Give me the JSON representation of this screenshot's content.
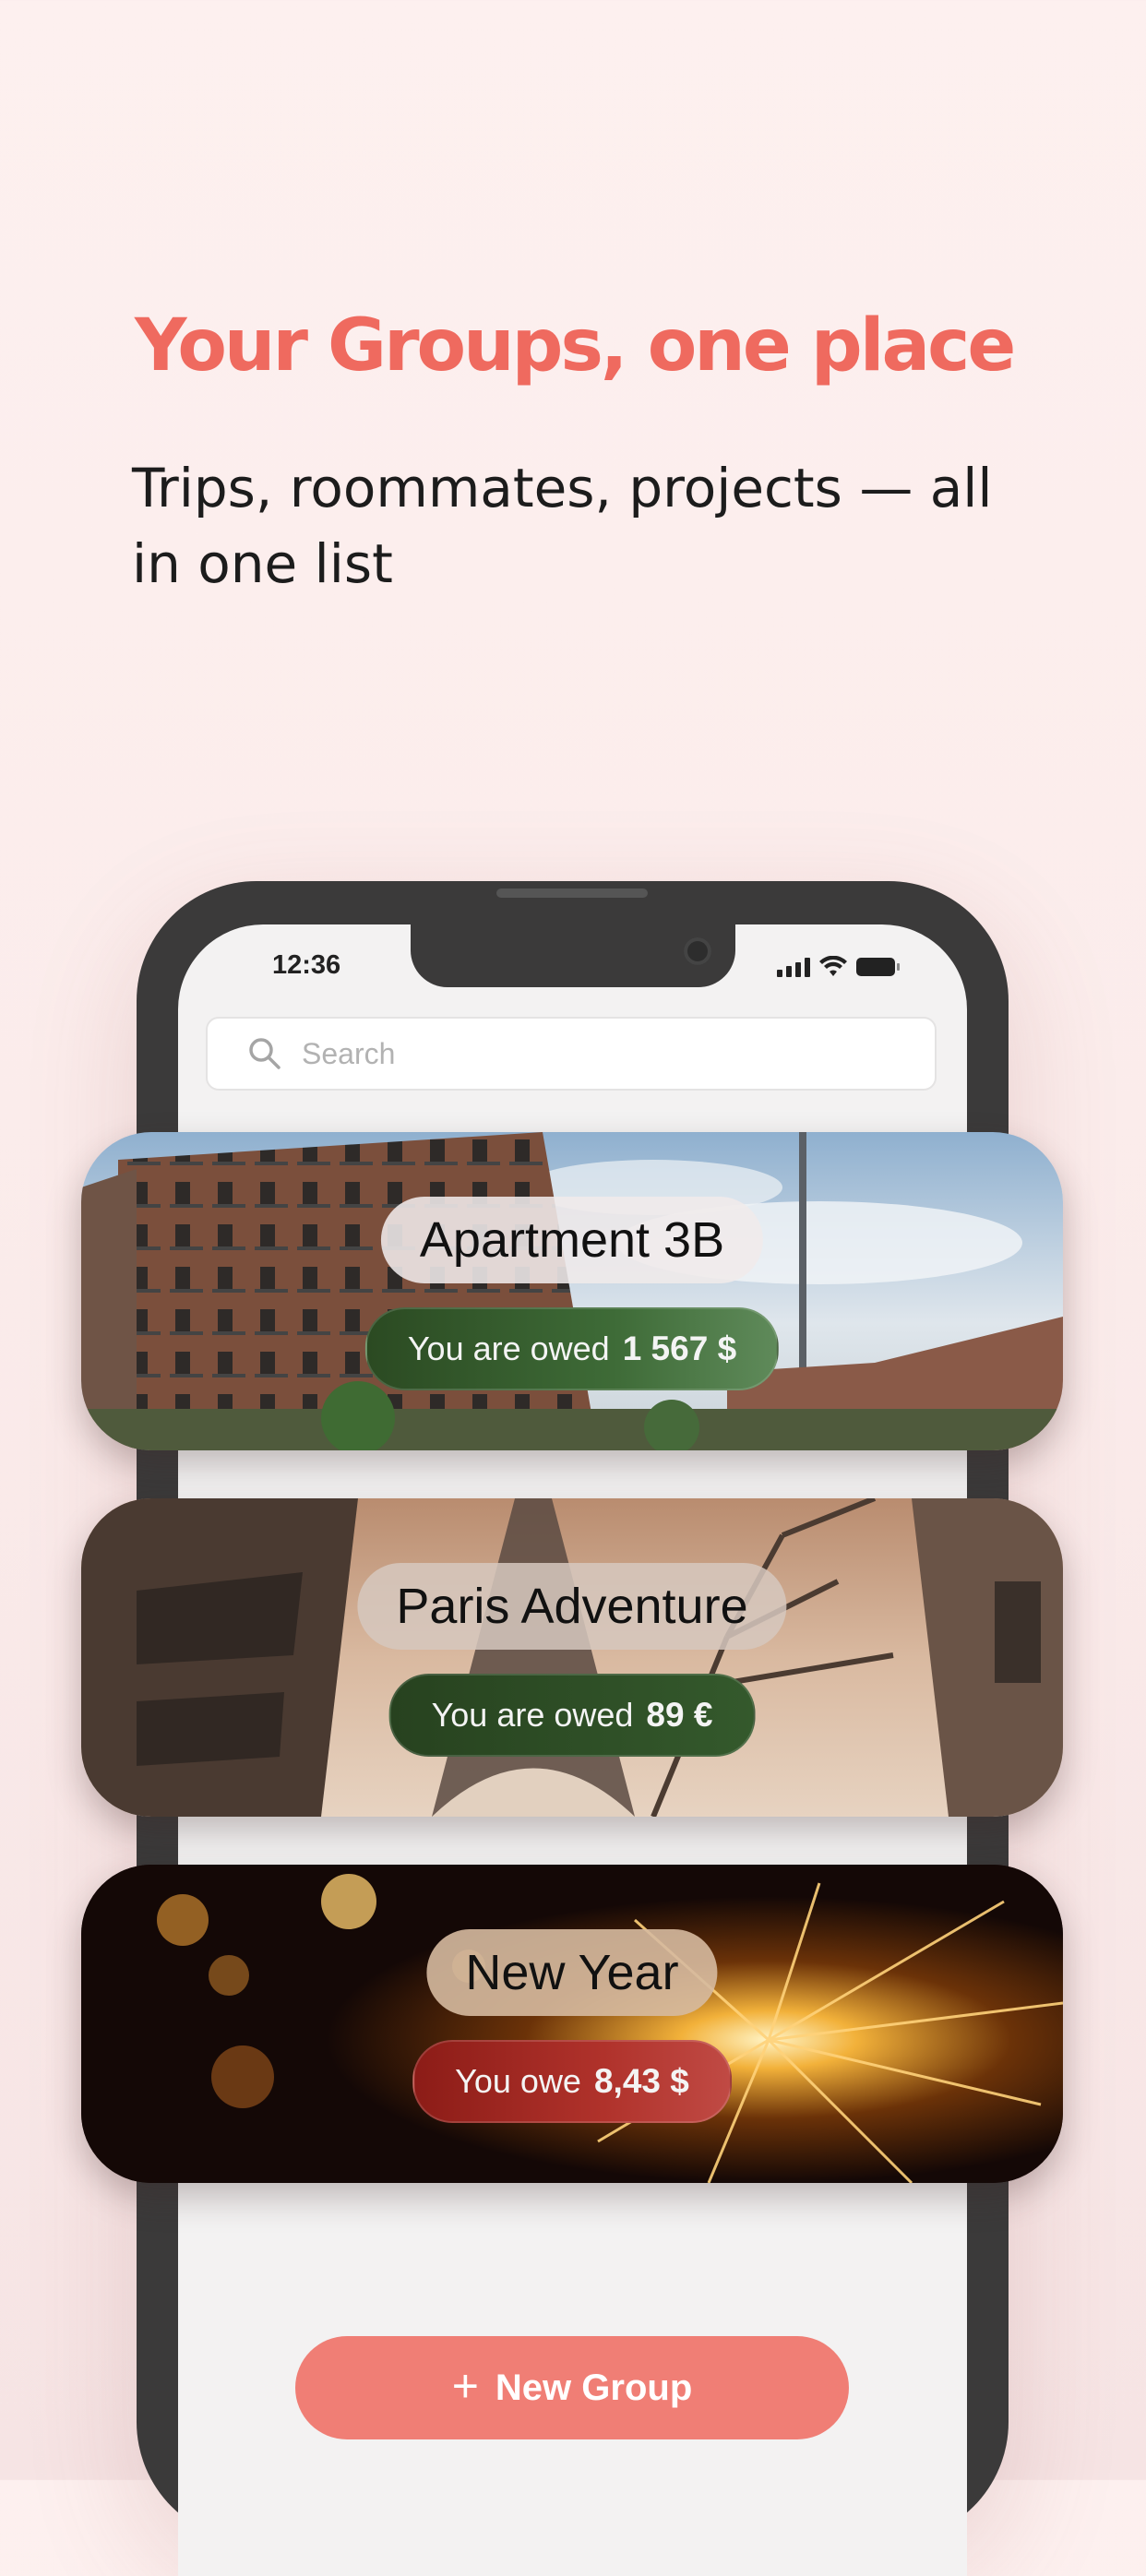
{
  "promo": {
    "headline": "Your Groups, one place",
    "subheadline": "Trips, roommates, projects — all in one list"
  },
  "status_bar": {
    "time": "12:36",
    "icons": [
      "cellular-signal-icon",
      "wifi-icon",
      "battery-icon"
    ]
  },
  "search": {
    "placeholder": "Search",
    "value": ""
  },
  "groups": [
    {
      "name": "Apartment 3B",
      "balance_label": "You are owed",
      "amount": "1 567 $",
      "status": "owed",
      "background": "apartment-building-photo"
    },
    {
      "name": "Paris Adventure",
      "balance_label": "You are owed",
      "amount": "89 €",
      "status": "owed",
      "background": "eiffel-tower-photo"
    },
    {
      "name": "New Year",
      "balance_label": "You owe",
      "amount": "8,43 $",
      "status": "owe",
      "background": "sparkler-photo"
    }
  ],
  "actions": {
    "new_group_label": "New Group",
    "new_group_icon": "plus-icon"
  },
  "colors": {
    "accent": "#ef6a5f",
    "button": "#f07e75",
    "owed_green": "#3e6b37",
    "owe_red": "#b0322b"
  }
}
